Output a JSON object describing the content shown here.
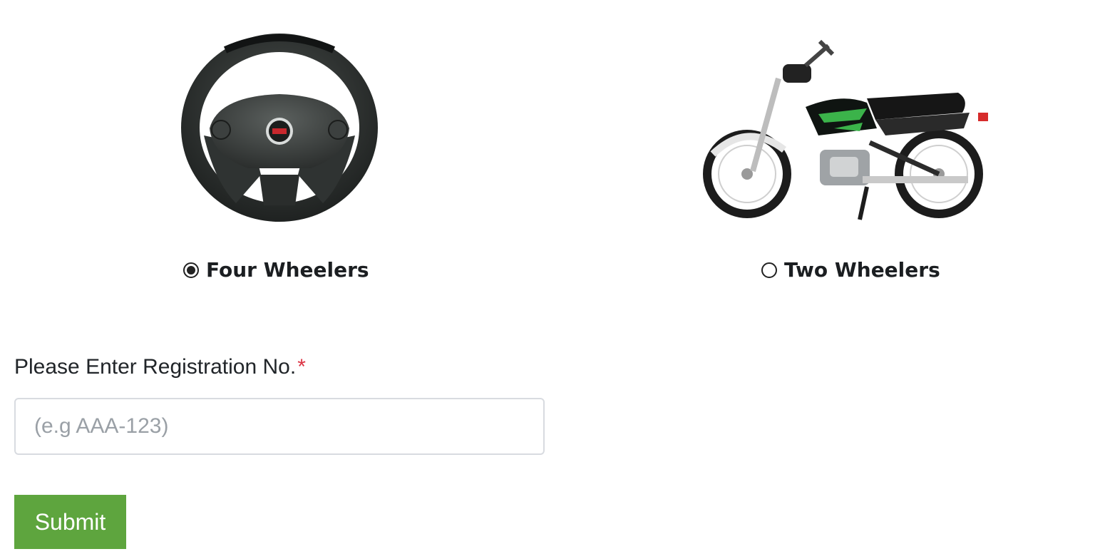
{
  "vehicle_types": [
    {
      "label": "Four Wheelers",
      "selected": true,
      "icon": "steering-wheel-icon"
    },
    {
      "label": "Two Wheelers",
      "selected": false,
      "icon": "motorcycle-icon"
    }
  ],
  "registration": {
    "label": "Please Enter Registration No.",
    "required_marker": "*",
    "placeholder": "(e.g AAA-123)",
    "value": ""
  },
  "form": {
    "submit_label": "Submit"
  },
  "colors": {
    "submit_bg": "#5ea53e",
    "required": "#dc3545",
    "moto_accent": "#3bb34a"
  }
}
